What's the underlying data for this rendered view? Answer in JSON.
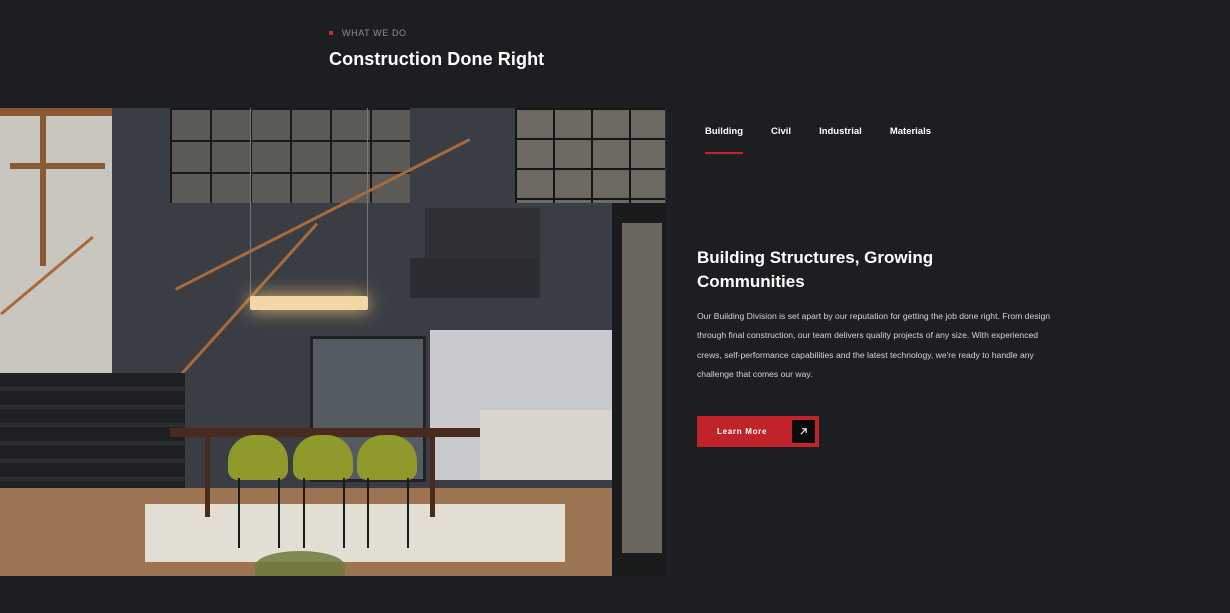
{
  "section": {
    "eyebrow": "WHAT WE DO",
    "title": "Construction Done Right"
  },
  "tabs": [
    {
      "label": "Building",
      "active": true
    },
    {
      "label": "Civil",
      "active": false
    },
    {
      "label": "Industrial",
      "active": false
    },
    {
      "label": "Materials",
      "active": false
    }
  ],
  "content": {
    "headline_line1": "Building Structures, Growing",
    "headline_line2": "Communities",
    "body": "Our Building Division is set apart by our reputation for getting the job done right. From design through final construction, our team delivers quality projects of any size. With experienced crews, self-performance capabilities and the latest technology, we're ready to handle any challenge that comes our way."
  },
  "cta": {
    "label": "Learn More",
    "icon": "arrow-up-right-icon"
  },
  "colors": {
    "background": "#1d1e21",
    "accent": "#c0232a",
    "text": "#ffffff",
    "muted": "#8f9096"
  }
}
